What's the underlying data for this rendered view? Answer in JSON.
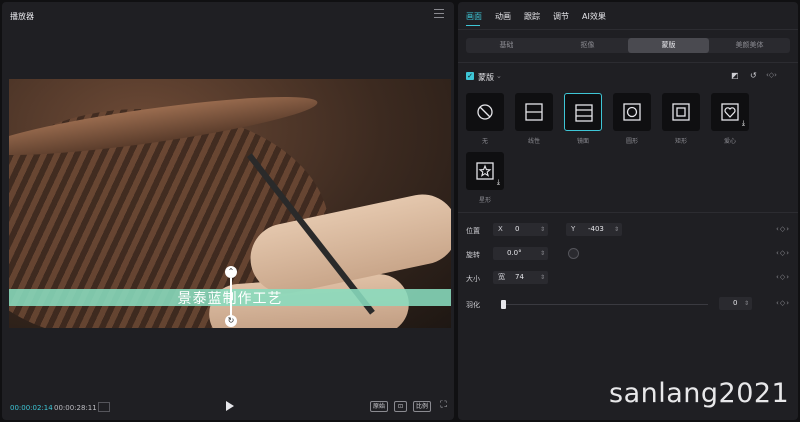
{
  "player": {
    "title": "播放器",
    "subtitle": "景泰蓝制作工艺",
    "time_current": "00:00:02:14",
    "time_total": "00:00:28:11",
    "btn_original": "原始",
    "btn_ratio": "比例"
  },
  "panel": {
    "tabs": [
      "画面",
      "动画",
      "跟踪",
      "调节",
      "AI效果"
    ],
    "subtabs": [
      "基础",
      "抠像",
      "蒙版",
      "美颜美体"
    ],
    "mask_label": "蒙版",
    "shapes": [
      {
        "label": "无",
        "icon": "none-icon"
      },
      {
        "label": "线性",
        "icon": "linear-mask-icon"
      },
      {
        "label": "镜面",
        "icon": "mirror-mask-icon"
      },
      {
        "label": "圆形",
        "icon": "circle-mask-icon"
      },
      {
        "label": "矩形",
        "icon": "rectangle-mask-icon"
      },
      {
        "label": "爱心",
        "icon": "heart-mask-icon"
      },
      {
        "label": "星形",
        "icon": "star-mask-icon"
      }
    ],
    "position": {
      "label": "位置",
      "x_key": "X",
      "x": "0",
      "y_key": "Y",
      "y": "-403"
    },
    "rotation": {
      "label": "旋转",
      "value": "0.0°"
    },
    "size": {
      "label": "大小",
      "key": "宽",
      "value": "74"
    },
    "feather": {
      "label": "羽化",
      "value": "0"
    }
  },
  "watermark": "sanlang2021",
  "colors": {
    "accent": "#3ec6d6",
    "subtitle_bg": "#89dcbe"
  }
}
